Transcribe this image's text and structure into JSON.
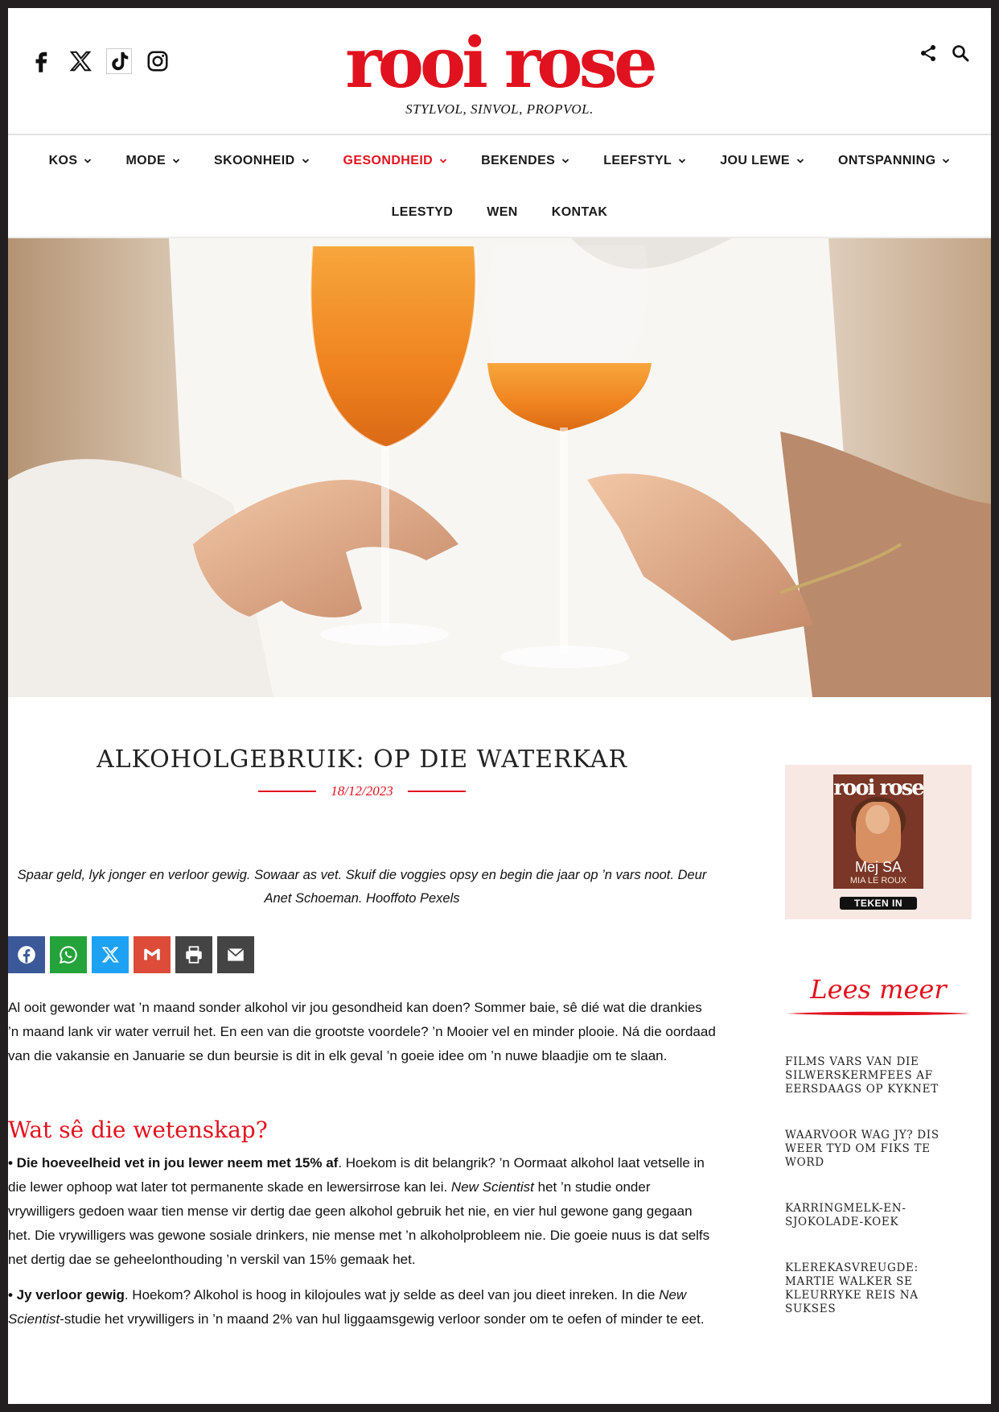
{
  "header": {
    "logo": "rooi rose",
    "tagline": "STYLVOL, SINVOL, PROPVOL.",
    "social_icons": [
      "facebook-icon",
      "x-icon",
      "tiktok-icon",
      "instagram-icon"
    ],
    "right_icons": [
      "share-icon",
      "search-icon"
    ]
  },
  "nav": {
    "row1": [
      {
        "label": "KOS",
        "active": false
      },
      {
        "label": "MODE",
        "active": false
      },
      {
        "label": "SKOONHEID",
        "active": false
      },
      {
        "label": "GESONDHEID",
        "active": true
      },
      {
        "label": "BEKENDES",
        "active": false
      },
      {
        "label": "LEEFSTYL",
        "active": false
      },
      {
        "label": "JOU LEWE",
        "active": false
      },
      {
        "label": "ONTSPANNING",
        "active": false
      }
    ],
    "row2": [
      {
        "label": "LEESTYD"
      },
      {
        "label": "WEN"
      },
      {
        "label": "KONTAK"
      }
    ]
  },
  "article": {
    "title": "ALKOHOLGEBRUIK: OP DIE WATERKAR",
    "date": "18/12/2023",
    "intro": "Spaar geld, lyk jonger en verloor gewig. Sowaar as vet. Skuif die voggies opsy en begin die jaar op ’n vars noot. Deur Anet Schoeman. Hooffoto Pexels",
    "share_buttons": [
      {
        "name": "facebook",
        "color": "#3b5998"
      },
      {
        "name": "whatsapp",
        "color": "#25a33b"
      },
      {
        "name": "x",
        "color": "#1da1f2"
      },
      {
        "name": "gmail",
        "color": "#dd4b39"
      },
      {
        "name": "print",
        "color": "#444444"
      },
      {
        "name": "email",
        "color": "#444444"
      }
    ],
    "paragraph1": "Al ooit gewonder wat ’n maand sonder alkohol vir jou gesondheid kan doen? Sommer baie, sê dié wat die drankies ’n maand lank vir water verruil het. En een van die grootste voordele? ’n Mooier vel en minder plooie. Ná die oordaad van die vakansie en Januarie se dun beursie is dit in elk geval ’n goeie idee om ’n nuwe blaadjie om te slaan.",
    "heading": "Wat sê die wetenskap?",
    "bullet1": {
      "bold": "• Die hoeveelheid vet in jou lewer neem met 15% af",
      "text_a": ". Hoekom is dit belangrik? ’n Oormaat alkohol laat vetselle in die lewer ophoop wat later tot permanente skade en lewersirrose kan lei. ",
      "italic": "New Scientist",
      "text_b": " het ’n studie onder vrywilligers gedoen waar tien mense vir dertig dae geen alkohol gebruik het nie, en vier hul gewone gang gegaan het. Die vrywilligers was gewone sosiale drinkers, nie mense met ’n alkoholprobleem nie. Die goeie nuus is dat selfs net dertig dae se geheelonthouding ’n verskil van 15% gemaak het."
    },
    "bullet2": {
      "bold": "• Jy verloor gewig",
      "text_a": ". Hoekom? Alkohol is hoog in kilojoules wat jy selde as deel van jou dieet inreken. In die ",
      "italic": "New Scientist",
      "text_b": "-studie het vrywilligers in ’n maand 2% van hul liggaamsgewig verloor sonder om te oefen of minder te eet."
    }
  },
  "sidebar": {
    "magazine": {
      "title": "rooi rose",
      "cover_name": "Mej SA",
      "cover_sub": "MIA LE ROUX",
      "cta": "TEKEN IN"
    },
    "lees_meer": "Lees meer",
    "related": [
      "FILMS VARS VAN DIE SILWERSKERMFEES AF EERSDAAGS OP KYKNET",
      "WAARVOOR WAG JY? DIS WEER TYD OM FIKS TE WORD",
      "KARRINGMELK-EN-SJOKOLADE-KOEK",
      "KLEREKASVREUGDE: MARTIE WALKER SE KLEURRYKE REIS NA SUKSES"
    ]
  },
  "colors": {
    "brand_red": "#e1121f",
    "frame": "#231f20"
  }
}
